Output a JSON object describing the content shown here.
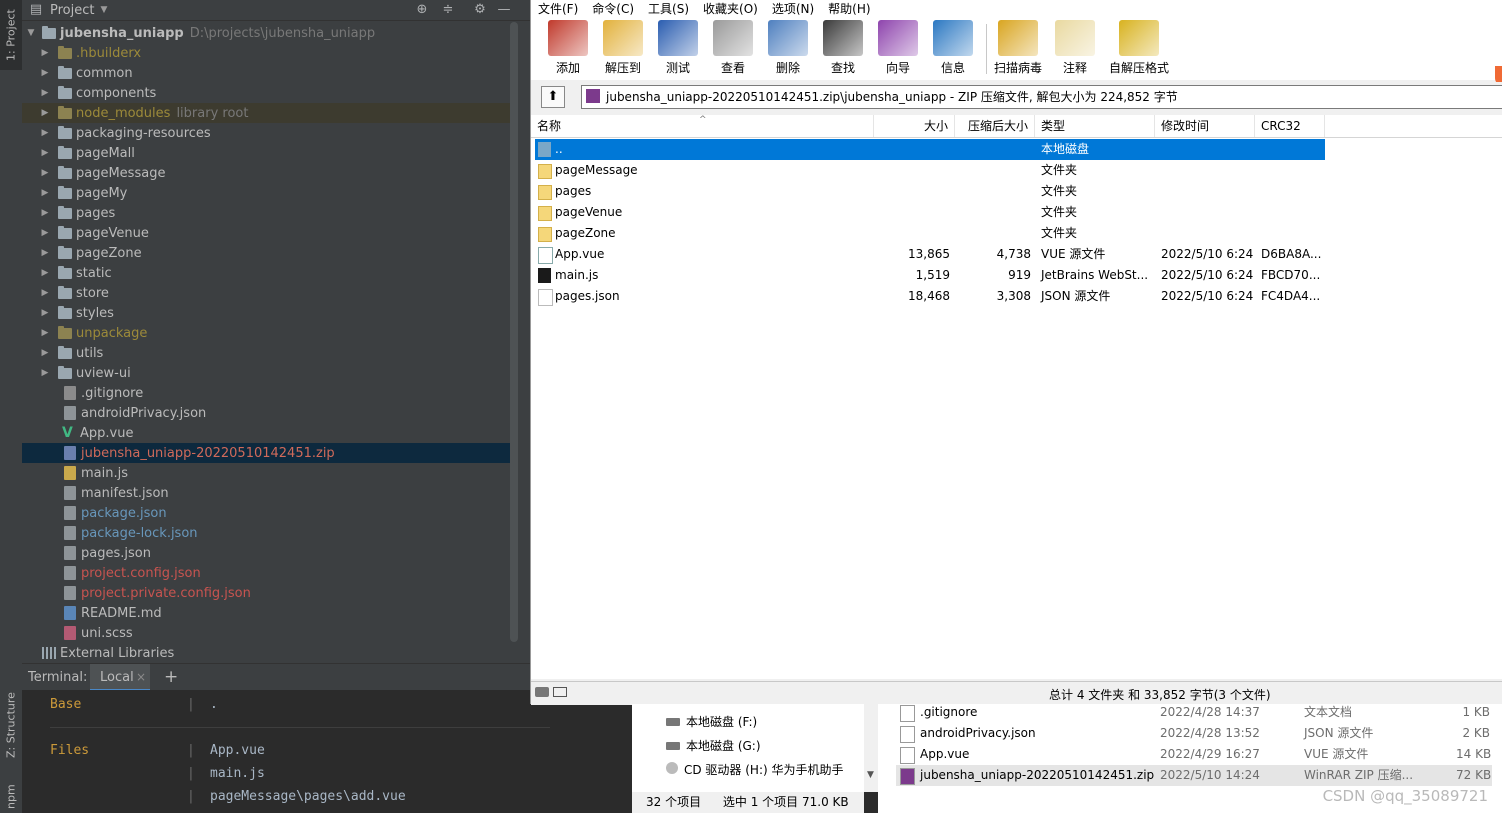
{
  "ide": {
    "side_tabs": {
      "project": "1: Project",
      "structure": "Z: Structure",
      "npm": "npm"
    },
    "project_panel": {
      "title": "Project",
      "root": {
        "name": "jubensha_uniapp",
        "path": "D:\\projects\\jubensha_uniapp"
      },
      "items": [
        {
          "label": ".hbuilderx",
          "kind": "folder",
          "color": "yellow",
          "expandable": true
        },
        {
          "label": "common",
          "kind": "folder",
          "expandable": true
        },
        {
          "label": "components",
          "kind": "folder",
          "expandable": true
        },
        {
          "label": "node_modules",
          "suffix": "library root",
          "kind": "folder",
          "color": "yellow",
          "excluded": true,
          "expandable": true
        },
        {
          "label": "packaging-resources",
          "kind": "folder",
          "expandable": true
        },
        {
          "label": "pageMall",
          "kind": "folder",
          "expandable": true
        },
        {
          "label": "pageMessage",
          "kind": "folder",
          "expandable": true
        },
        {
          "label": "pageMy",
          "kind": "folder",
          "expandable": true
        },
        {
          "label": "pages",
          "kind": "folder",
          "expandable": true
        },
        {
          "label": "pageVenue",
          "kind": "folder",
          "expandable": true
        },
        {
          "label": "pageZone",
          "kind": "folder",
          "expandable": true
        },
        {
          "label": "static",
          "kind": "folder",
          "expandable": true
        },
        {
          "label": "store",
          "kind": "folder",
          "expandable": true
        },
        {
          "label": "styles",
          "kind": "folder",
          "expandable": true
        },
        {
          "label": "unpackage",
          "kind": "folder",
          "color": "yellow",
          "expandable": true
        },
        {
          "label": "utils",
          "kind": "folder",
          "expandable": true
        },
        {
          "label": "uview-ui",
          "kind": "folder",
          "expandable": true
        },
        {
          "label": ".gitignore",
          "kind": "git"
        },
        {
          "label": "androidPrivacy.json",
          "kind": "json"
        },
        {
          "label": "App.vue",
          "kind": "vue"
        },
        {
          "label": "jubensha_uniapp-20220510142451.zip",
          "kind": "zip",
          "color": "zip",
          "selected": true
        },
        {
          "label": "main.js",
          "kind": "js"
        },
        {
          "label": "manifest.json",
          "kind": "json"
        },
        {
          "label": "package.json",
          "kind": "json",
          "color": "blue"
        },
        {
          "label": "package-lock.json",
          "kind": "json",
          "color": "blue"
        },
        {
          "label": "pages.json",
          "kind": "json"
        },
        {
          "label": "project.config.json",
          "kind": "json",
          "color": "red"
        },
        {
          "label": "project.private.config.json",
          "kind": "json",
          "color": "red"
        },
        {
          "label": "README.md",
          "kind": "md"
        },
        {
          "label": "uni.scss",
          "kind": "scss"
        }
      ],
      "external": "External Libraries"
    },
    "terminal": {
      "label": "Terminal:",
      "tab": "Local",
      "close": "×",
      "add": "+",
      "lines": [
        {
          "key": "Base",
          "sep": "|",
          "val": "."
        },
        {
          "key": "Files",
          "sep": "|",
          "val": "App.vue"
        },
        {
          "key": "",
          "sep": "|",
          "val": "main.js"
        },
        {
          "key": "",
          "sep": "|",
          "val": "pageMessage\\pages\\add.vue"
        }
      ]
    }
  },
  "winrar": {
    "menu": [
      "文件(F)",
      "命令(C)",
      "工具(S)",
      "收藏夹(O)",
      "选项(N)",
      "帮助(H)"
    ],
    "toolbar": [
      {
        "label": "添加",
        "icon": "add-archive-icon",
        "color": "#c0392b"
      },
      {
        "label": "解压到",
        "icon": "extract-to-icon",
        "color": "#e2b13c"
      },
      {
        "label": "测试",
        "icon": "test-icon",
        "color": "#2a5db0"
      },
      {
        "label": "查看",
        "icon": "view-icon",
        "color": "#9a9a9a"
      },
      {
        "label": "删除",
        "icon": "delete-icon",
        "color": "#4e7fbf"
      },
      {
        "label": "查找",
        "icon": "find-icon",
        "color": "#3a3a3a"
      },
      {
        "label": "向导",
        "icon": "wizard-icon",
        "color": "#8e44ad"
      },
      {
        "label": "信息",
        "icon": "info-icon",
        "color": "#2b78c2"
      },
      {
        "label": "扫描病毒",
        "icon": "scan-virus-icon",
        "color": "#d9a520"
      },
      {
        "label": "注释",
        "icon": "comment-icon",
        "color": "#e9d9a0"
      },
      {
        "label": "自解压格式",
        "icon": "sfx-icon",
        "color": "#d8b21f"
      }
    ],
    "path": "jubensha_uniapp-20220510142451.zip\\jubensha_uniapp - ZIP 压缩文件, 解包大小为 224,852 字节",
    "columns": [
      "名称",
      "大小",
      "压缩后大小",
      "类型",
      "修改时间",
      "CRC32"
    ],
    "rows": [
      {
        "name": "..",
        "size": "",
        "packed": "",
        "type": "本地磁盘",
        "modified": "",
        "crc": "",
        "icon": "up",
        "selected": true
      },
      {
        "name": "pageMessage",
        "size": "",
        "packed": "",
        "type": "文件夹",
        "modified": "",
        "crc": "",
        "icon": "folder-y"
      },
      {
        "name": "pages",
        "size": "",
        "packed": "",
        "type": "文件夹",
        "modified": "",
        "crc": "",
        "icon": "folder-y"
      },
      {
        "name": "pageVenue",
        "size": "",
        "packed": "",
        "type": "文件夹",
        "modified": "",
        "crc": "",
        "icon": "folder-y"
      },
      {
        "name": "pageZone",
        "size": "",
        "packed": "",
        "type": "文件夹",
        "modified": "",
        "crc": "",
        "icon": "folder-y"
      },
      {
        "name": "App.vue",
        "size": "13,865",
        "packed": "4,738",
        "type": "VUE 源文件",
        "modified": "2022/5/10 6:24",
        "crc": "D6BA8A...",
        "icon": "vue"
      },
      {
        "name": "main.js",
        "size": "1,519",
        "packed": "919",
        "type": "JetBrains WebSt...",
        "modified": "2022/5/10 6:24",
        "crc": "FBCD70...",
        "icon": "ws"
      },
      {
        "name": "pages.json",
        "size": "18,468",
        "packed": "3,308",
        "type": "JSON 源文件",
        "modified": "2022/5/10 6:24",
        "crc": "FC4DA4...",
        "icon": "jsonf"
      }
    ],
    "status": "总计 4 文件夹 和 33,852 字节(3 个文件)"
  },
  "explorer": {
    "drives": [
      {
        "label": "本地磁盘 (F:)"
      },
      {
        "label": "本地磁盘 (G:)"
      },
      {
        "label": "CD 驱动器 (H:) 华为手机助手"
      }
    ],
    "status": {
      "count": "32 个项目",
      "selected": "选中 1 个项目  71.0 KB"
    },
    "files": [
      {
        "name": ".gitignore",
        "date": "2022/4/28 14:37",
        "type": "文本文档",
        "size": "1 KB"
      },
      {
        "name": "androidPrivacy.json",
        "date": "2022/4/28 13:52",
        "type": "JSON 源文件",
        "size": "2 KB"
      },
      {
        "name": "App.vue",
        "date": "2022/4/29 16:27",
        "type": "VUE 源文件",
        "size": "14 KB"
      },
      {
        "name": "jubensha_uniapp-20220510142451.zip",
        "date": "2022/5/10 14:24",
        "type": "WinRAR ZIP 压缩...",
        "size": "72 KB",
        "selected": true
      }
    ],
    "watermark": "CSDN @qq_35089721"
  }
}
